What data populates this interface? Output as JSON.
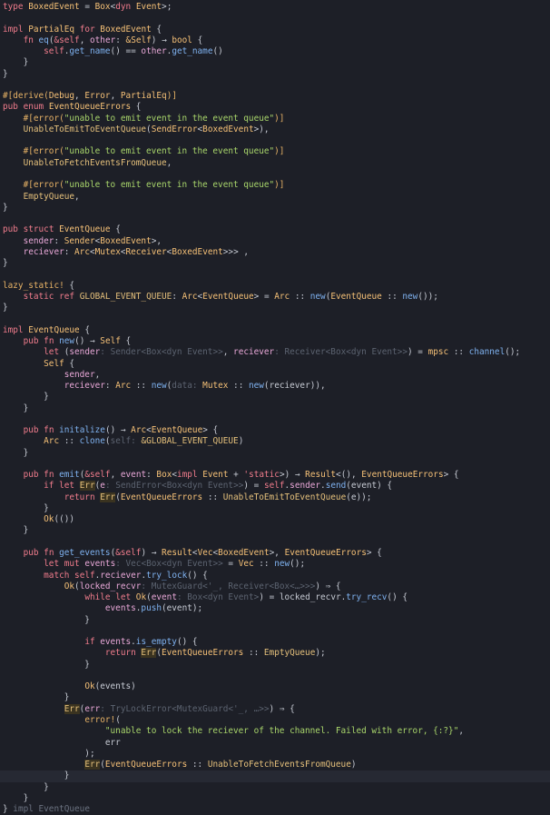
{
  "editor": {
    "language": "rust",
    "cursor_line": 69,
    "lines": [
      [
        [
          "type",
          "kw"
        ],
        [
          " "
        ],
        [
          "BoxedEvent",
          "ty"
        ],
        [
          " = "
        ],
        [
          "Box",
          "ty"
        ],
        [
          "<"
        ],
        [
          "dyn",
          "kw"
        ],
        [
          " "
        ],
        [
          "Event",
          "ty"
        ],
        [
          ">;"
        ]
      ],
      [],
      [
        [
          "impl",
          "kw"
        ],
        [
          " "
        ],
        [
          "PartialEq",
          "ty"
        ],
        [
          " "
        ],
        [
          "for",
          "kw"
        ],
        [
          " "
        ],
        [
          "BoxedEvent",
          "ty"
        ],
        [
          " {"
        ]
      ],
      [
        [
          "    "
        ],
        [
          "fn",
          "kw"
        ],
        [
          " "
        ],
        [
          "eq",
          "fn"
        ],
        [
          "("
        ],
        [
          "&self",
          "self"
        ],
        [
          ", "
        ],
        [
          "other",
          "var"
        ],
        [
          ": "
        ],
        [
          "&Self",
          "ty"
        ],
        [
          ") → "
        ],
        [
          "bool",
          "ty"
        ],
        [
          " {"
        ]
      ],
      [
        [
          "        "
        ],
        [
          "self",
          "self"
        ],
        [
          "."
        ],
        [
          "get_name",
          "fn"
        ],
        [
          "() == "
        ],
        [
          "other",
          "var"
        ],
        [
          "."
        ],
        [
          "get_name",
          "fn"
        ],
        [
          "()"
        ]
      ],
      [
        [
          "    }"
        ]
      ],
      [
        [
          "}"
        ]
      ],
      [],
      [
        [
          "#[derive(",
          "attr"
        ],
        [
          "Debug",
          "ty"
        ],
        [
          ", "
        ],
        [
          "Error",
          "ty"
        ],
        [
          ", "
        ],
        [
          "PartialEq",
          "ty"
        ],
        [
          ")]",
          "attr"
        ]
      ],
      [
        [
          "pub",
          "kw"
        ],
        [
          " "
        ],
        [
          "enum",
          "kw"
        ],
        [
          " "
        ],
        [
          "EventQueueErrors",
          "ty"
        ],
        [
          " {"
        ]
      ],
      [
        [
          "    "
        ],
        [
          "#[error(",
          "attr"
        ],
        [
          "\"unable to emit event in the event queue\"",
          "str"
        ],
        [
          ")]",
          "attr"
        ]
      ],
      [
        [
          "    "
        ],
        [
          "UnableToEmitToEventQueue",
          "const"
        ],
        [
          "("
        ],
        [
          "SendError",
          "ty"
        ],
        [
          "<"
        ],
        [
          "BoxedEvent",
          "ty"
        ],
        [
          ">),"
        ]
      ],
      [],
      [
        [
          "    "
        ],
        [
          "#[error(",
          "attr"
        ],
        [
          "\"unable to emit event in the event queue\"",
          "str"
        ],
        [
          ")]",
          "attr"
        ]
      ],
      [
        [
          "    "
        ],
        [
          "UnableToFetchEventsFromQueue",
          "const"
        ],
        [
          ","
        ]
      ],
      [],
      [
        [
          "    "
        ],
        [
          "#[error(",
          "attr"
        ],
        [
          "\"unable to emit event in the event queue\"",
          "str"
        ],
        [
          ")]",
          "attr"
        ]
      ],
      [
        [
          "    "
        ],
        [
          "EmptyQueue",
          "const"
        ],
        [
          ","
        ]
      ],
      [
        [
          "}"
        ]
      ],
      [],
      [
        [
          "pub",
          "kw"
        ],
        [
          " "
        ],
        [
          "struct",
          "kw"
        ],
        [
          " "
        ],
        [
          "EventQueue",
          "ty"
        ],
        [
          " {"
        ]
      ],
      [
        [
          "    "
        ],
        [
          "sender",
          "var"
        ],
        [
          ": "
        ],
        [
          "Sender",
          "ty"
        ],
        [
          "<"
        ],
        [
          "BoxedEvent",
          "ty"
        ],
        [
          ">,"
        ]
      ],
      [
        [
          "    "
        ],
        [
          "reciever",
          "var"
        ],
        [
          ": "
        ],
        [
          "Arc",
          "ty"
        ],
        [
          "<"
        ],
        [
          "Mutex",
          "ty"
        ],
        [
          "<"
        ],
        [
          "Receiver",
          "ty"
        ],
        [
          "<"
        ],
        [
          "BoxedEvent",
          "ty"
        ],
        [
          ">>> ,"
        ]
      ],
      [
        [
          "}"
        ]
      ],
      [],
      [
        [
          "lazy_static!",
          "mac"
        ],
        [
          " {"
        ]
      ],
      [
        [
          "    "
        ],
        [
          "static",
          "kw"
        ],
        [
          " "
        ],
        [
          "ref",
          "kw"
        ],
        [
          " "
        ],
        [
          "GLOBAL_EVENT_QUEUE",
          "const"
        ],
        [
          ": "
        ],
        [
          "Arc",
          "ty"
        ],
        [
          "<"
        ],
        [
          "EventQueue",
          "ty"
        ],
        [
          "> = "
        ],
        [
          "Arc",
          "ty"
        ],
        [
          " :: "
        ],
        [
          "new",
          "fn"
        ],
        [
          "("
        ],
        [
          "EventQueue",
          "ty"
        ],
        [
          " :: "
        ],
        [
          "new",
          "fn"
        ],
        [
          "());"
        ]
      ],
      [
        [
          "}"
        ]
      ],
      [],
      [
        [
          "impl",
          "kw"
        ],
        [
          " "
        ],
        [
          "EventQueue",
          "ty"
        ],
        [
          " {"
        ]
      ],
      [
        [
          "    "
        ],
        [
          "pub",
          "kw"
        ],
        [
          " "
        ],
        [
          "fn",
          "kw"
        ],
        [
          " "
        ],
        [
          "new",
          "fn"
        ],
        [
          "() → "
        ],
        [
          "Self",
          "ty"
        ],
        [
          " {"
        ]
      ],
      [
        [
          "        "
        ],
        [
          "let",
          "kw"
        ],
        [
          " ("
        ],
        [
          "sender",
          "var"
        ],
        [
          ": ",
          "hint"
        ],
        [
          "Sender<Box<dyn Event>>",
          "hint"
        ],
        [
          ", "
        ],
        [
          "reciever",
          "var"
        ],
        [
          ": ",
          "hint"
        ],
        [
          "Receiver<Box<dyn Event>>",
          "hint"
        ],
        [
          ") = "
        ],
        [
          "mpsc",
          "ty"
        ],
        [
          " :: "
        ],
        [
          "channel",
          "fn"
        ],
        [
          "();"
        ]
      ],
      [
        [
          "        "
        ],
        [
          "Self",
          "ty"
        ],
        [
          " {"
        ]
      ],
      [
        [
          "            "
        ],
        [
          "sender",
          "var"
        ],
        [
          ","
        ]
      ],
      [
        [
          "            "
        ],
        [
          "reciever",
          "var"
        ],
        [
          ": "
        ],
        [
          "Arc",
          "ty"
        ],
        [
          " :: "
        ],
        [
          "new",
          "fn"
        ],
        [
          "("
        ],
        [
          "data: ",
          "hint"
        ],
        [
          "Mutex",
          "ty"
        ],
        [
          " :: "
        ],
        [
          "new",
          "fn"
        ],
        [
          "(reciever)),"
        ]
      ],
      [
        [
          "        }"
        ]
      ],
      [
        [
          "    }"
        ]
      ],
      [],
      [
        [
          "    "
        ],
        [
          "pub",
          "kw"
        ],
        [
          " "
        ],
        [
          "fn",
          "kw"
        ],
        [
          " "
        ],
        [
          "initalize",
          "fn"
        ],
        [
          "() → "
        ],
        [
          "Arc",
          "ty"
        ],
        [
          "<"
        ],
        [
          "EventQueue",
          "ty"
        ],
        [
          "> {"
        ]
      ],
      [
        [
          "        "
        ],
        [
          "Arc",
          "ty"
        ],
        [
          " :: "
        ],
        [
          "clone",
          "fn"
        ],
        [
          "("
        ],
        [
          "self: ",
          "hint"
        ],
        [
          "&GLOBAL_EVENT_QUEUE",
          "const"
        ],
        [
          ")"
        ]
      ],
      [
        [
          "    }"
        ]
      ],
      [],
      [
        [
          "    "
        ],
        [
          "pub",
          "kw"
        ],
        [
          " "
        ],
        [
          "fn",
          "kw"
        ],
        [
          " "
        ],
        [
          "emit",
          "fn"
        ],
        [
          "("
        ],
        [
          "&self",
          "self"
        ],
        [
          ", "
        ],
        [
          "event",
          "var"
        ],
        [
          ": "
        ],
        [
          "Box",
          "ty"
        ],
        [
          "<"
        ],
        [
          "impl",
          "kw"
        ],
        [
          " "
        ],
        [
          "Event",
          "ty"
        ],
        [
          " + "
        ],
        [
          "'static",
          "kw"
        ],
        [
          ">) → "
        ],
        [
          "Result",
          "ty"
        ],
        [
          "<(), "
        ],
        [
          "EventQueueErrors",
          "ty"
        ],
        [
          "> {"
        ]
      ],
      [
        [
          "        "
        ],
        [
          "if",
          "kw"
        ],
        [
          " "
        ],
        [
          "let",
          "kw"
        ],
        [
          " "
        ],
        [
          "Err",
          "err"
        ],
        [
          "("
        ],
        [
          "e",
          "var"
        ],
        [
          ": ",
          "hint"
        ],
        [
          "SendError<Box<dyn Event>>",
          "hint"
        ],
        [
          ") = "
        ],
        [
          "self",
          "self"
        ],
        [
          "."
        ],
        [
          "sender",
          "var"
        ],
        [
          "."
        ],
        [
          "send",
          "fn"
        ],
        [
          "(event) {"
        ]
      ],
      [
        [
          "            "
        ],
        [
          "return",
          "kw"
        ],
        [
          " "
        ],
        [
          "Err",
          "err"
        ],
        [
          "("
        ],
        [
          "EventQueueErrors",
          "ty"
        ],
        [
          " :: "
        ],
        [
          "UnableToEmitToEventQueue",
          "const"
        ],
        [
          "(e));"
        ]
      ],
      [
        [
          "        }"
        ]
      ],
      [
        [
          "        "
        ],
        [
          "Ok",
          "ty"
        ],
        [
          "(())"
        ]
      ],
      [
        [
          "    }"
        ]
      ],
      [],
      [
        [
          "    "
        ],
        [
          "pub",
          "kw"
        ],
        [
          " "
        ],
        [
          "fn",
          "kw"
        ],
        [
          " "
        ],
        [
          "get_events",
          "fn"
        ],
        [
          "("
        ],
        [
          "&self",
          "self"
        ],
        [
          ") → "
        ],
        [
          "Result",
          "ty"
        ],
        [
          "<"
        ],
        [
          "Vec",
          "ty"
        ],
        [
          "<"
        ],
        [
          "BoxedEvent",
          "ty"
        ],
        [
          ">, "
        ],
        [
          "EventQueueErrors",
          "ty"
        ],
        [
          "> {"
        ]
      ],
      [
        [
          "        "
        ],
        [
          "let",
          "kw"
        ],
        [
          " "
        ],
        [
          "mut",
          "kw"
        ],
        [
          " "
        ],
        [
          "events",
          "var"
        ],
        [
          ": ",
          "hint"
        ],
        [
          "Vec<Box<dyn Event>>",
          "hint"
        ],
        [
          " = "
        ],
        [
          "Vec",
          "ty"
        ],
        [
          " :: "
        ],
        [
          "new",
          "fn"
        ],
        [
          "();"
        ]
      ],
      [
        [
          "        "
        ],
        [
          "match",
          "kw"
        ],
        [
          " "
        ],
        [
          "self",
          "self"
        ],
        [
          "."
        ],
        [
          "reciever",
          "var"
        ],
        [
          "."
        ],
        [
          "try_lock",
          "fn"
        ],
        [
          "() {"
        ]
      ],
      [
        [
          "            "
        ],
        [
          "Ok",
          "ty"
        ],
        [
          "("
        ],
        [
          "locked_recvr",
          "var"
        ],
        [
          ": ",
          "hint"
        ],
        [
          "MutexGuard<'_, Receiver<Box<…>>>",
          "hint"
        ],
        [
          ") ⇒ {"
        ]
      ],
      [
        [
          "                "
        ],
        [
          "while",
          "kw"
        ],
        [
          " "
        ],
        [
          "let",
          "kw"
        ],
        [
          " "
        ],
        [
          "Ok",
          "ty"
        ],
        [
          "("
        ],
        [
          "event",
          "var"
        ],
        [
          ": ",
          "hint"
        ],
        [
          "Box<dyn Event>",
          "hint"
        ],
        [
          ") = locked_recvr."
        ],
        [
          "try_recv",
          "fn"
        ],
        [
          "() {"
        ]
      ],
      [
        [
          "                    "
        ],
        [
          "events",
          "var"
        ],
        [
          "."
        ],
        [
          "push",
          "fn"
        ],
        [
          "(event);"
        ]
      ],
      [
        [
          "                }"
        ]
      ],
      [],
      [
        [
          "                "
        ],
        [
          "if",
          "kw"
        ],
        [
          " "
        ],
        [
          "events",
          "var"
        ],
        [
          "."
        ],
        [
          "is_empty",
          "fn"
        ],
        [
          "() {"
        ]
      ],
      [
        [
          "                    "
        ],
        [
          "return",
          "kw"
        ],
        [
          " "
        ],
        [
          "Err",
          "err"
        ],
        [
          "("
        ],
        [
          "EventQueueErrors",
          "ty"
        ],
        [
          " :: "
        ],
        [
          "EmptyQueue",
          "const"
        ],
        [
          ");"
        ]
      ],
      [
        [
          "                }"
        ]
      ],
      [],
      [
        [
          "                "
        ],
        [
          "Ok",
          "ty"
        ],
        [
          "(events)"
        ]
      ],
      [
        [
          "            }"
        ]
      ],
      [
        [
          "            "
        ],
        [
          "Err",
          "err"
        ],
        [
          "("
        ],
        [
          "err",
          "var"
        ],
        [
          ": ",
          "hint"
        ],
        [
          "TryLockError<MutexGuard<'_, …>>",
          "hint"
        ],
        [
          ") ⇒ {"
        ]
      ],
      [
        [
          "                "
        ],
        [
          "error!",
          "mac"
        ],
        [
          "("
        ]
      ],
      [
        [
          "                    "
        ],
        [
          "\"unable to lock the reciever of the channel. Failed with error, {:?}\"",
          "str"
        ],
        [
          ","
        ]
      ],
      [
        [
          "                    err"
        ]
      ],
      [
        [
          "                );"
        ]
      ],
      [
        [
          "                "
        ],
        [
          "E",
          "err"
        ],
        [
          "|CURSOR|"
        ],
        [
          "rr",
          "err"
        ],
        [
          "("
        ],
        [
          "EventQueueErrors",
          "ty"
        ],
        [
          " :: "
        ],
        [
          "UnableToFetchEventsFromQueue",
          "const"
        ],
        [
          ")"
        ]
      ],
      [
        [
          "            }"
        ]
      ],
      [
        [
          "        }"
        ]
      ],
      [
        [
          "    }"
        ]
      ],
      [
        [
          "} "
        ],
        [
          "impl EventQueue",
          "fold"
        ]
      ]
    ]
  }
}
